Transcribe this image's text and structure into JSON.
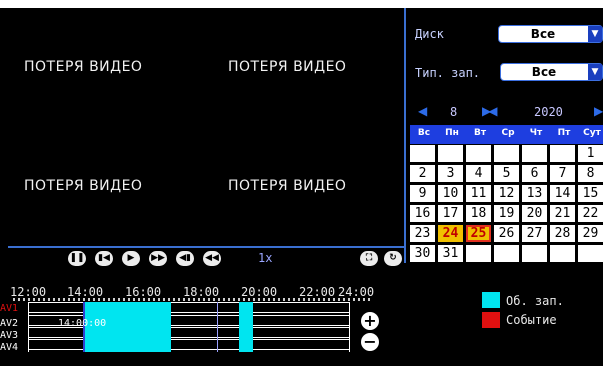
{
  "video_tiles": [
    "ПОТЕРЯ ВИДЕО",
    "ПОТЕРЯ ВИДЕО",
    "ПОТЕРЯ ВИДЕО",
    "ПОТЕРЯ ВИДЕО"
  ],
  "filters": {
    "disk_label": "Диск",
    "disk_value": "Все",
    "record_type_label": "Тип. зап.",
    "record_type_value": "Все"
  },
  "calendar": {
    "month": "8",
    "year": "2020",
    "weekdays": [
      "Вс",
      "Пн",
      "Вт",
      "Ср",
      "Чт",
      "Пт",
      "Сут"
    ],
    "days": [
      [
        "",
        "",
        "",
        "",
        "",
        "",
        "1"
      ],
      [
        "2",
        "3",
        "4",
        "5",
        "6",
        "7",
        "8"
      ],
      [
        "9",
        "10",
        "11",
        "12",
        "13",
        "14",
        "15"
      ],
      [
        "16",
        "17",
        "18",
        "19",
        "20",
        "21",
        "22"
      ],
      [
        "23",
        "24",
        "25",
        "26",
        "27",
        "28",
        "29"
      ],
      [
        "30",
        "31",
        "",
        "",
        "",
        "",
        ""
      ]
    ],
    "highlighted_days": [
      "24",
      "25"
    ],
    "highlight_color": "#f0c000"
  },
  "playback": {
    "speed": "1x",
    "buttons": [
      "pause-icon",
      "step-back-icon",
      "play-icon",
      "fast-forward-icon",
      "slow-icon",
      "rewind-icon"
    ]
  },
  "timeline": {
    "ticks": [
      "12:00",
      "14:00",
      "16:00",
      "18:00",
      "20:00",
      "22:00",
      "24:00"
    ],
    "channels": [
      "AV1",
      "AV2",
      "AV3",
      "AV4"
    ],
    "cursor_time": "14:00:00"
  },
  "legend": {
    "normal_label": "Об. зап.",
    "normal_color": "#00e5f0",
    "event_label": "Событие",
    "event_color": "#e01010"
  }
}
